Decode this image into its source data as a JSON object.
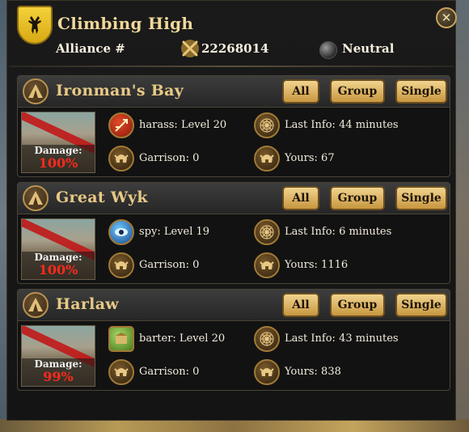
{
  "window": {
    "title": "Climbing High",
    "close_glyph": "✕",
    "alliance_label": "Alliance #",
    "alliance_id": "22268014",
    "status": "Neutral",
    "icons": {
      "crest": "stag-crest-icon",
      "alliance": "crossed-swords-icon",
      "status": "neutral-orb-icon",
      "close": "close-icon"
    }
  },
  "colors": {
    "accent_gold": "#e7c986",
    "button_gold": "#d8ae5c",
    "damage_red": "#ff2a1c",
    "panel_bg": "#121212"
  },
  "panels": [
    {
      "name": "Ironman's Bay",
      "buttons": {
        "all": "All",
        "group": "Group",
        "single": "Single"
      },
      "damage_label": "Damage:",
      "damage_value": "100%",
      "action_icon": "arrows-icon",
      "action_text": "harass: Level 20",
      "last_info": "Last Info: 44 minutes",
      "garrison": "Garrison: 0",
      "yours": "Yours: 67"
    },
    {
      "name": "Great Wyk",
      "buttons": {
        "all": "All",
        "group": "Group",
        "single": "Single"
      },
      "damage_label": "Damage:",
      "damage_value": "100%",
      "action_icon": "spy-eye-icon",
      "action_text": "spy: Level 19",
      "last_info": "Last Info: 6 minutes",
      "garrison": "Garrison: 0",
      "yours": "Yours: 1116"
    },
    {
      "name": "Harlaw",
      "buttons": {
        "all": "All",
        "group": "Group",
        "single": "Single"
      },
      "damage_label": "Damage:",
      "damage_value": "99%",
      "action_icon": "barter-icon",
      "action_text": "barter: Level 20",
      "last_info": "Last Info: 43 minutes",
      "garrison": "Garrison: 0",
      "yours": "Yours: 838"
    }
  ]
}
